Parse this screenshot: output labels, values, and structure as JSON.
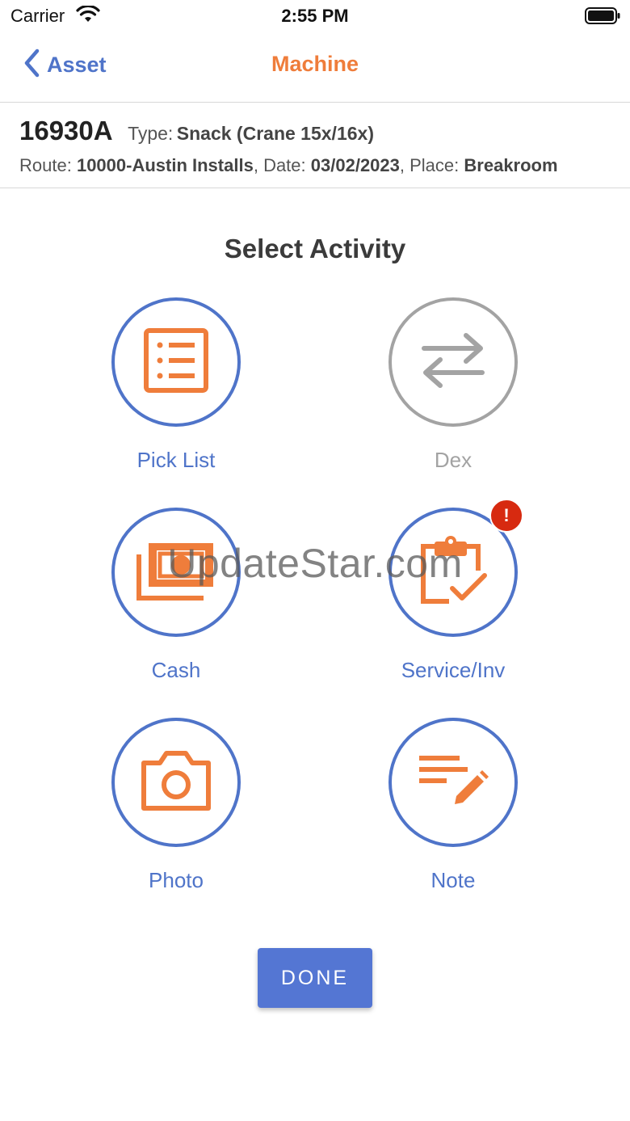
{
  "status_bar": {
    "carrier": "Carrier",
    "time": "2:55 PM",
    "wifi_icon": "wifi-icon",
    "battery_icon": "battery-icon"
  },
  "nav": {
    "back_label": "Asset",
    "title": "Machine"
  },
  "machine": {
    "id": "16930A",
    "type_label": "Type:",
    "type_value": "Snack (Crane 15x/16x)",
    "route_label": "Route:",
    "route_value": "10000-Austin Installs",
    "date_label": "Date:",
    "date_value": "03/02/2023",
    "place_label": "Place:",
    "place_value": "Breakroom"
  },
  "activity": {
    "title": "Select Activity",
    "items": [
      {
        "label": "Pick List",
        "icon": "list-icon",
        "enabled": true
      },
      {
        "label": "Dex",
        "icon": "swap-arrows-icon",
        "enabled": false
      },
      {
        "label": "Cash",
        "icon": "cash-icon",
        "enabled": true
      },
      {
        "label": "Service/Inv",
        "icon": "clipboard-check-icon",
        "enabled": true,
        "badge": "!"
      },
      {
        "label": "Photo",
        "icon": "camera-icon",
        "enabled": true
      },
      {
        "label": "Note",
        "icon": "note-edit-icon",
        "enabled": true
      }
    ]
  },
  "watermark": "UpdateStar.com",
  "done_label": "DONE",
  "colors": {
    "accent_blue": "#4f74c9",
    "accent_orange": "#ef7d3b",
    "disabled_gray": "#a3a3a3",
    "alert_red": "#d72a10"
  }
}
